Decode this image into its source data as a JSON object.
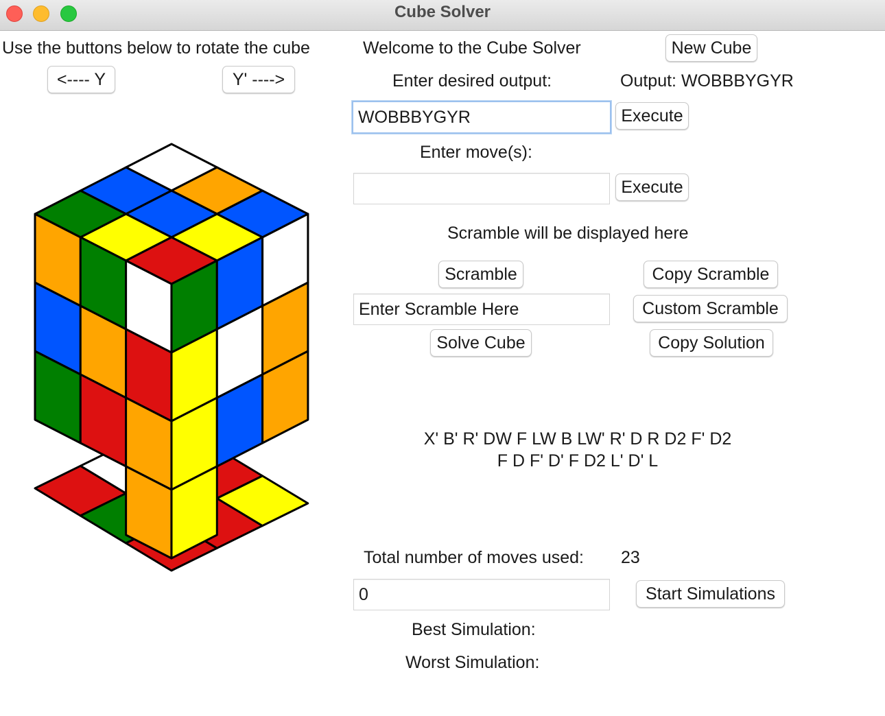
{
  "window": {
    "title": "Cube Solver"
  },
  "rotate": {
    "instruction": "Use the buttons below to rotate the cube",
    "left_button": "<---- Y",
    "right_button": "Y' ---->"
  },
  "welcome": "Welcome to the Cube Solver",
  "new_cube_button": "New Cube",
  "output": {
    "prompt": "Enter desired output:",
    "label": "Output: WOBBBYGYR",
    "input_value": "WOBBBYGYR",
    "execute_label": "Execute"
  },
  "moves": {
    "prompt": "Enter move(s):",
    "input_value": "",
    "execute_label": "Execute"
  },
  "scramble": {
    "display": "Scramble will be displayed here",
    "scramble_button": "Scramble",
    "copy_scramble_button": "Copy Scramble",
    "input_value": "Enter Scramble Here",
    "custom_scramble_button": "Custom Scramble",
    "solve_button": "Solve Cube",
    "copy_solution_button": "Copy Solution"
  },
  "solution": {
    "line1": "X' B' R' DW F LW B LW' R' D R D2 F' D2",
    "line2": "F D F' D' F D2 L' D' L"
  },
  "stats": {
    "total_moves_label": "Total number of moves used:",
    "total_moves_value": "23",
    "simulations_input": "0",
    "start_simulations_button": "Start Simulations",
    "best_label": "Best Simulation:",
    "worst_label": "Worst Simulation:"
  },
  "cube": {
    "colors": {
      "W": "#ffffff",
      "O": "#ffa500",
      "B": "#0055ff",
      "G": "#007f00",
      "Y": "#ffff00",
      "R": "#dd1111"
    },
    "top": [
      [
        "W",
        "O",
        "B"
      ],
      [
        "B",
        "B",
        "Y"
      ],
      [
        "G",
        "Y",
        "R"
      ]
    ],
    "left": [
      [
        "O",
        "G",
        "W"
      ],
      [
        "B",
        "O",
        "R"
      ],
      [
        "G",
        "R",
        "O"
      ],
      [
        "",
        "",
        "O"
      ]
    ],
    "right": [
      [
        "G",
        "B",
        "W"
      ],
      [
        "Y",
        "W",
        "O"
      ],
      [
        "Y",
        "B",
        "O"
      ],
      [
        "Y",
        "",
        ""
      ]
    ],
    "bottom": [
      [
        "R",
        "W",
        "B"
      ],
      [
        "G",
        "G",
        "R"
      ],
      [
        "R",
        "R",
        "Y"
      ]
    ]
  }
}
